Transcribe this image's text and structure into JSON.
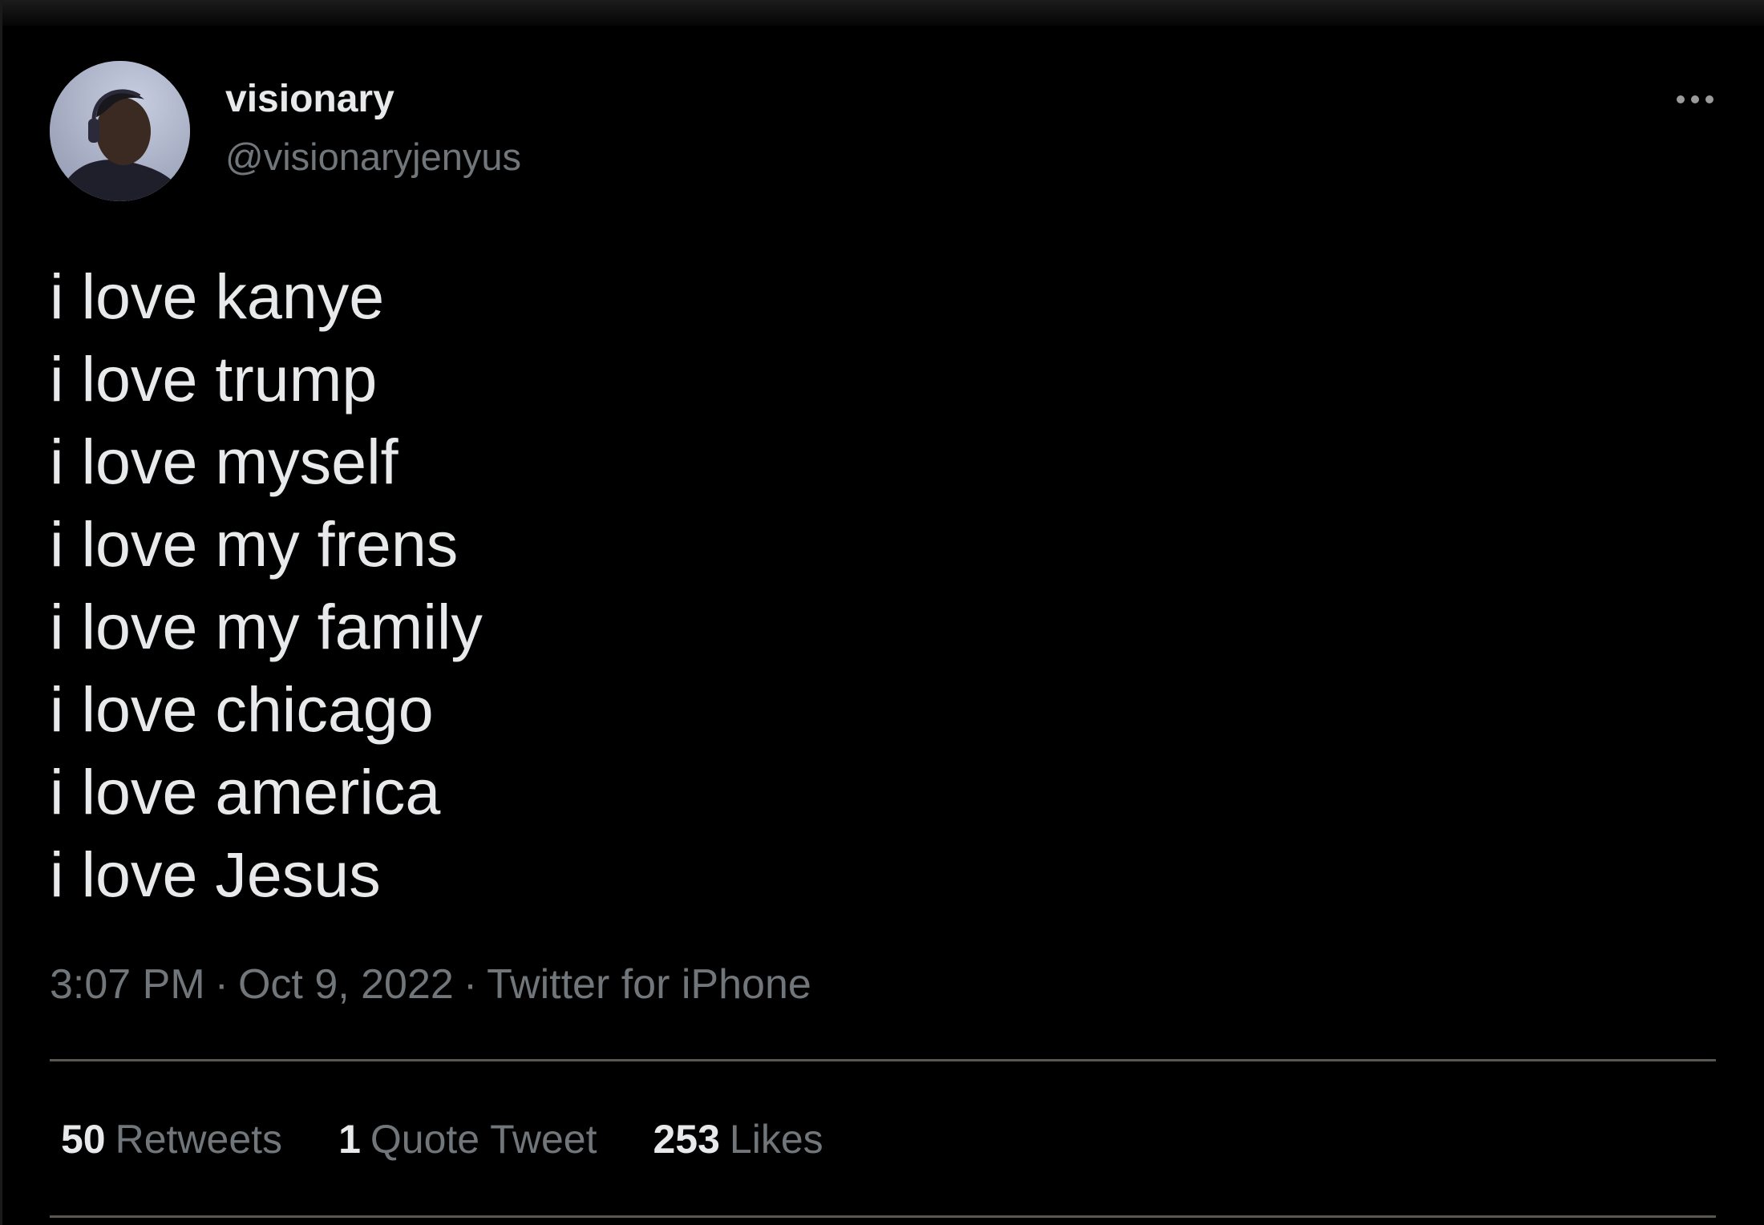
{
  "tweet": {
    "author": {
      "display_name": "visionary",
      "handle": "@visionaryjenyus",
      "avatar_icon": "profile-photo"
    },
    "lines": [
      "i love kanye",
      "i love trump",
      "i love myself",
      "i love my frens",
      "i love my family",
      "i love chicago",
      "i love america",
      "i love Jesus"
    ],
    "meta": {
      "time": "3:07 PM",
      "date": "Oct 9, 2022",
      "source": "Twitter for iPhone",
      "separator": "·"
    },
    "stats": [
      {
        "count": "50",
        "label": "Retweets"
      },
      {
        "count": "1",
        "label": "Quote Tweet"
      },
      {
        "count": "253",
        "label": "Likes"
      }
    ],
    "more_icon": "more-horizontal-icon"
  },
  "colors": {
    "background": "#000000",
    "primary_text": "#e7e9ea",
    "secondary_text": "#71767b",
    "divider": "#5a5650"
  }
}
